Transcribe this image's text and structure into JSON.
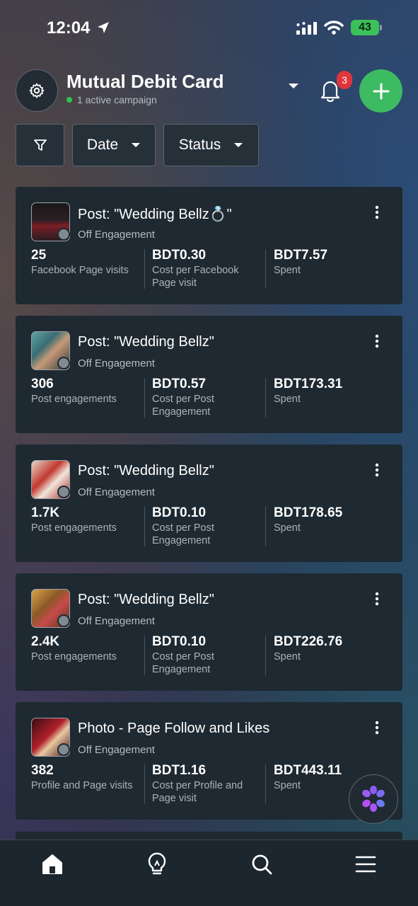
{
  "status_bar": {
    "time": "12:04",
    "battery": "43"
  },
  "header": {
    "account_name": "Mutual Debit Card",
    "subtitle": "1 active campaign",
    "notification_count": "3"
  },
  "filters": {
    "date_label": "Date",
    "status_label": "Status"
  },
  "campaigns": [
    {
      "title": "Post: \"Wedding Bellz💍\"",
      "status": "Off  Engagement",
      "metric1_value": "25",
      "metric1_label": "Facebook Page visits",
      "metric2_value": "BDT0.30",
      "metric2_label": "Cost per Facebook Page visit",
      "metric3_value": "BDT7.57",
      "metric3_label": "Spent"
    },
    {
      "title": "Post: \"Wedding Bellz\"",
      "status": "Off  Engagement",
      "metric1_value": "306",
      "metric1_label": "Post engagements",
      "metric2_value": "BDT0.57",
      "metric2_label": "Cost per Post Engagement",
      "metric3_value": "BDT173.31",
      "metric3_label": "Spent"
    },
    {
      "title": "Post: \"Wedding Bellz\"",
      "status": "Off  Engagement",
      "metric1_value": "1.7K",
      "metric1_label": "Post engagements",
      "metric2_value": "BDT0.10",
      "metric2_label": "Cost per Post Engagement",
      "metric3_value": "BDT178.65",
      "metric3_label": "Spent"
    },
    {
      "title": "Post: \"Wedding Bellz\"",
      "status": "Off  Engagement",
      "metric1_value": "2.4K",
      "metric1_label": "Post engagements",
      "metric2_value": "BDT0.10",
      "metric2_label": "Cost per Post Engagement",
      "metric3_value": "BDT226.76",
      "metric3_label": "Spent"
    },
    {
      "title": "Photo - Page Follow and Likes",
      "status": "Off  Engagement",
      "metric1_value": "382",
      "metric1_label": "Profile and Page visits",
      "metric2_value": "BDT1.16",
      "metric2_label": "Cost per Profile and Page visit",
      "metric3_value": "BDT443.11",
      "metric3_label": "Spent"
    }
  ],
  "nav": [
    "home-icon",
    "lightbulb-icon",
    "search-icon",
    "menu-icon"
  ],
  "colors": {
    "accent_green": "#3dbb63",
    "badge_red": "#e0353b",
    "card_bg": "#1e2931"
  }
}
